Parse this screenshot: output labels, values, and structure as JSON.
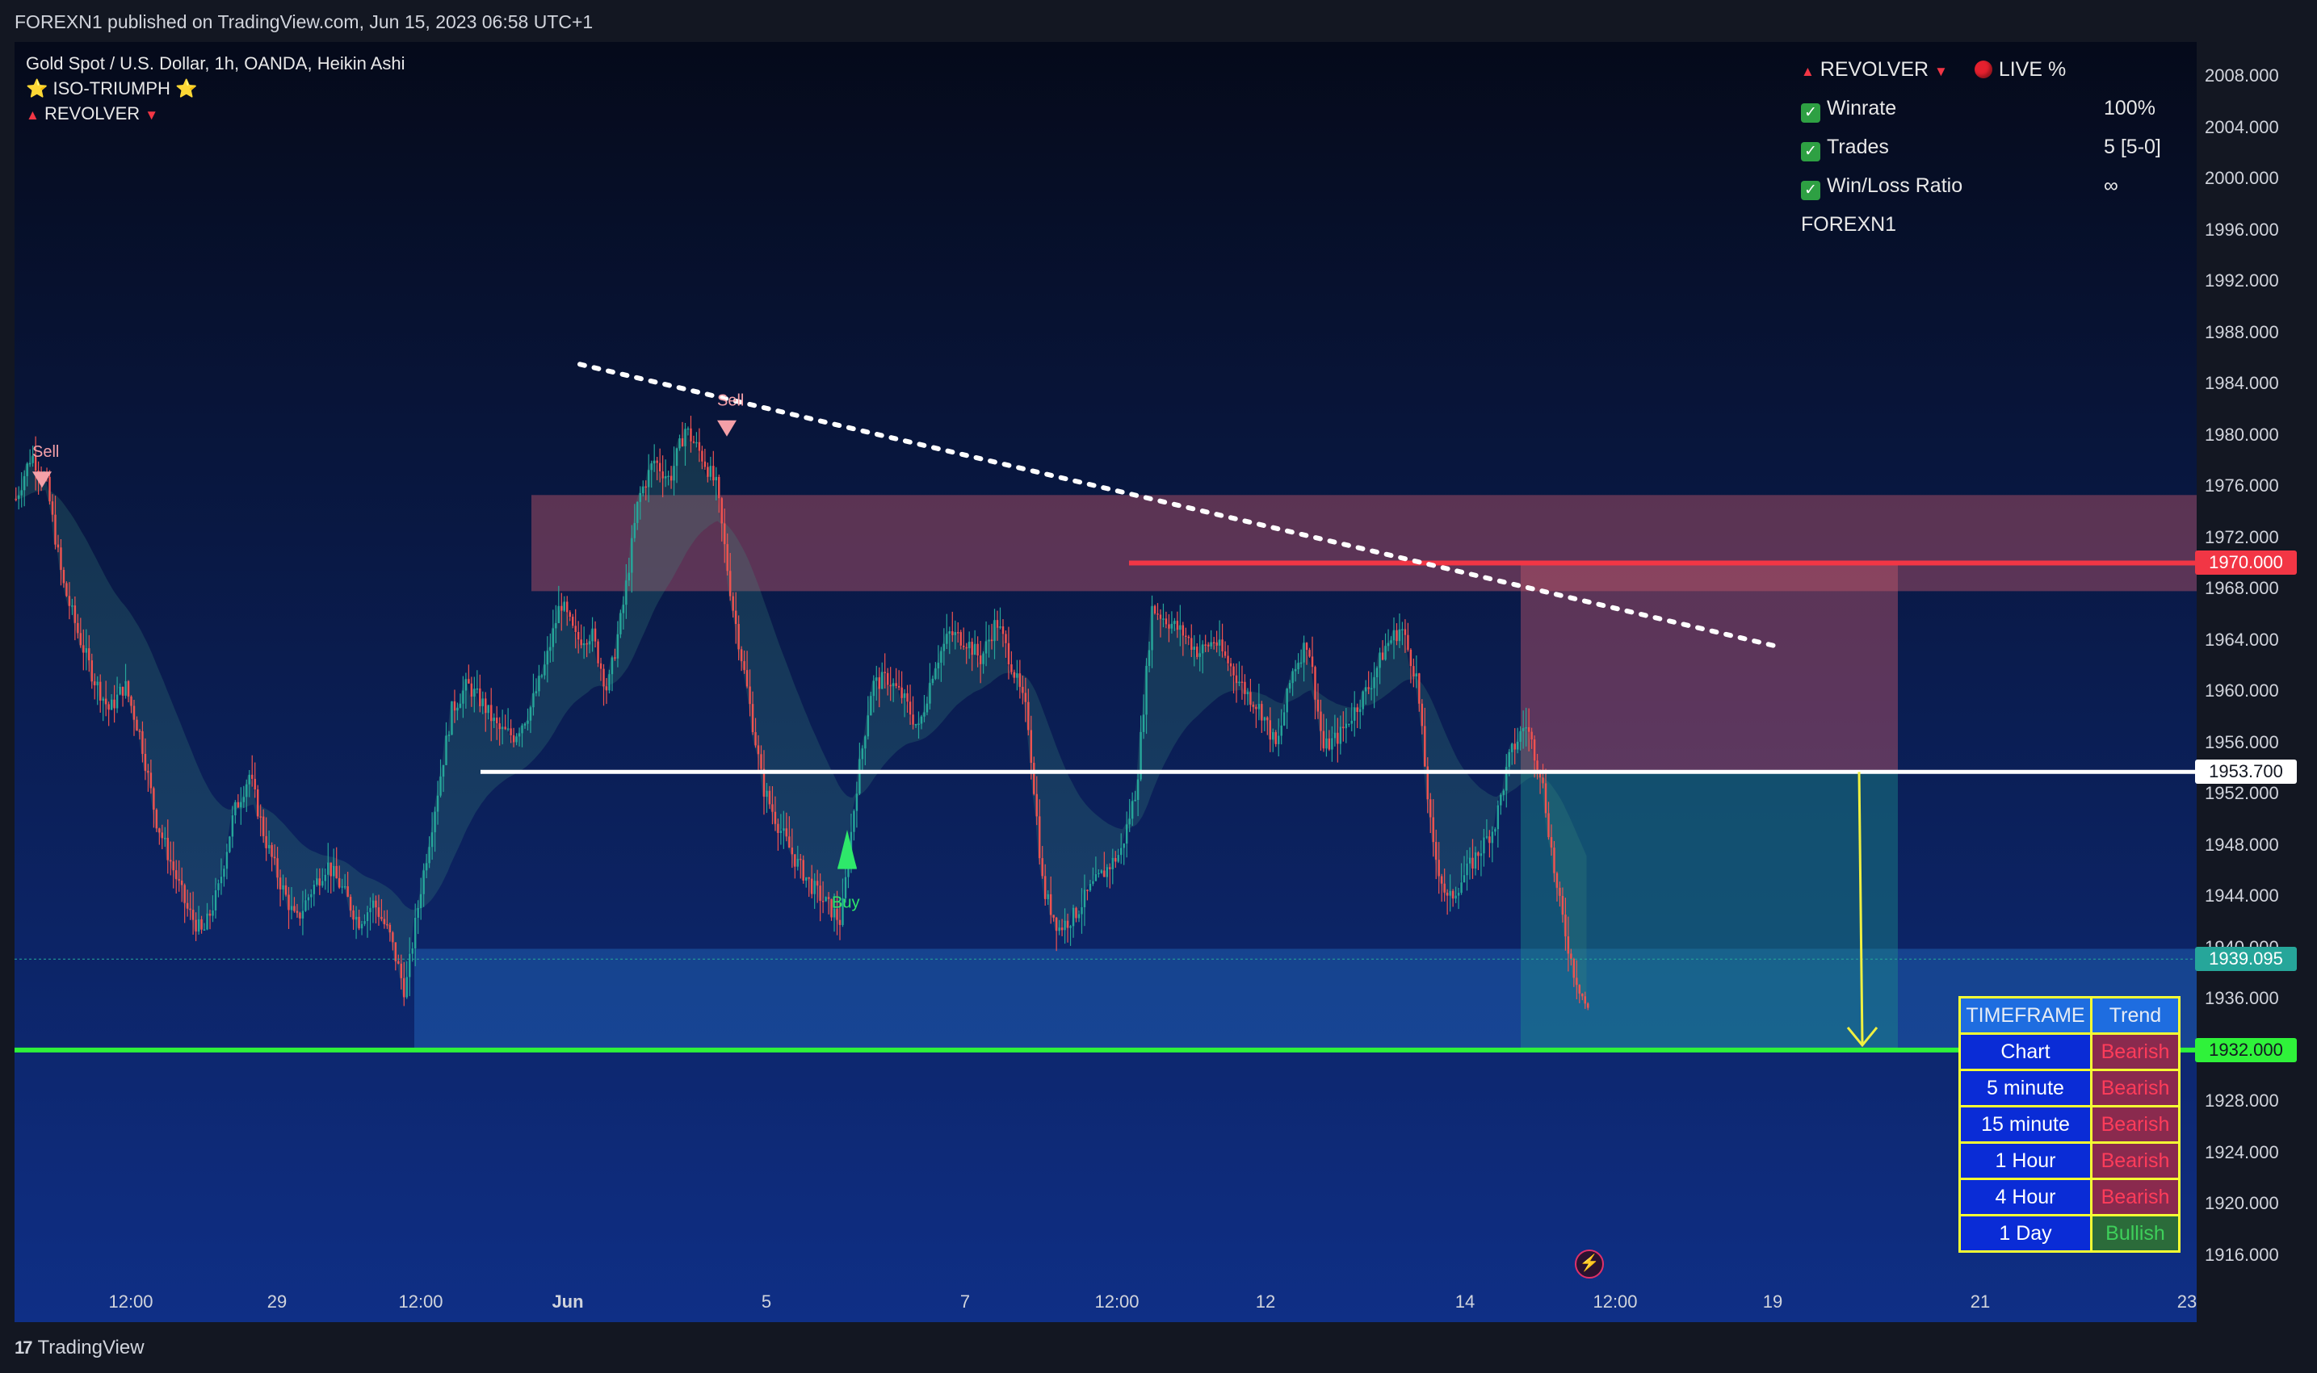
{
  "header": {
    "published": "FOREXN1 published on TradingView.com, Jun 15, 2023 06:58 UTC+1"
  },
  "footer": {
    "brand": "TradingView",
    "logo_mark": "17"
  },
  "legend": {
    "symbol": "Gold Spot / U.S. Dollar, 1h, OANDA, Heikin Ashi",
    "indicator1": "⭐ ISO-TRIUMPH ⭐",
    "indicator2": "REVOLVER"
  },
  "stats": {
    "title": "REVOLVER",
    "live": "LIVE %",
    "rows": [
      {
        "label": "Winrate",
        "value": "100%"
      },
      {
        "label": "Trades",
        "value": "5 [5-0]"
      },
      {
        "label": "Win/Loss Ratio",
        "value": "∞"
      }
    ],
    "author": "FOREXN1"
  },
  "trend_table": {
    "headers": [
      "TIMEFRAME",
      "Trend"
    ],
    "rows": [
      {
        "tf": "Chart",
        "trend": "Bearish"
      },
      {
        "tf": "5 minute",
        "trend": "Bearish"
      },
      {
        "tf": "15 minute",
        "trend": "Bearish"
      },
      {
        "tf": "1 Hour",
        "trend": "Bearish"
      },
      {
        "tf": "4 Hour",
        "trend": "Bearish"
      },
      {
        "tf": "1 Day",
        "trend": "Bullish"
      }
    ]
  },
  "signals": {
    "sell": "Sell",
    "buy": "Buy"
  },
  "colors": {
    "bg_top": "#050a1a",
    "bg_bottom": "#0f2f86",
    "up": "#26a69a",
    "down": "#ef5350",
    "resistance_zone": "#c2566b",
    "support_zone": "#2b7fd9",
    "line_1970": "#f23645",
    "line_1953": "#ffffff",
    "line_1932": "#2ff23a",
    "line_1939": "#26a69a"
  },
  "chart_data": {
    "type": "candlestick",
    "symbol": "XAUUSD",
    "interval": "1h",
    "ylim": [
      1913,
      2011
    ],
    "y_ticks": [
      "2008.000",
      "2004.000",
      "2000.000",
      "1996.000",
      "1992.000",
      "1988.000",
      "1984.000",
      "1980.000",
      "1976.000",
      "1972.000",
      "1968.000",
      "1964.000",
      "1960.000",
      "1956.000",
      "1952.000",
      "1948.000",
      "1944.000",
      "1940.000",
      "1936.000",
      "1932.000",
      "1928.000",
      "1924.000",
      "1920.000",
      "1916.000"
    ],
    "x_ticks": [
      "12:00",
      "29",
      "12:00",
      "Jun",
      "5",
      "7",
      "12:00",
      "12",
      "14",
      "12:00",
      "19",
      "21",
      "23"
    ],
    "price_labels": [
      {
        "value": 1970.0,
        "text": "1970.000"
      },
      {
        "value": 1953.7,
        "text": "1953.700"
      },
      {
        "value": 1939.095,
        "text": "1939.095"
      },
      {
        "value": 1932.0,
        "text": "1932.000"
      }
    ],
    "zones": [
      {
        "name": "resistance",
        "from": 1967.8,
        "to": 1975.3
      },
      {
        "name": "support",
        "from": 1932.0,
        "to": 1939.9
      }
    ],
    "trendline": {
      "from": 1985.5,
      "to": 1963.5,
      "style": "dotted"
    },
    "close_path": [
      1975.0,
      1978.5,
      1976.0,
      1968.5,
      1964.5,
      1961.0,
      1958.5,
      1960.5,
      1956.5,
      1950.0,
      1946.5,
      1943.0,
      1941.0,
      1944.5,
      1950.5,
      1953.5,
      1948.5,
      1945.0,
      1942.0,
      1944.5,
      1946.5,
      1944.5,
      1942.0,
      1943.5,
      1941.0,
      1936.5,
      1944.5,
      1951.5,
      1958.5,
      1960.5,
      1959.0,
      1957.0,
      1956.5,
      1958.5,
      1962.0,
      1967.0,
      1964.0,
      1964.5,
      1960.0,
      1966.5,
      1975.0,
      1978.0,
      1976.5,
      1980.5,
      1978.5,
      1976.0,
      1967.0,
      1960.0,
      1952.5,
      1949.5,
      1947.0,
      1945.0,
      1943.5,
      1942.0,
      1952.5,
      1960.5,
      1961.0,
      1959.5,
      1957.0,
      1962.0,
      1964.5,
      1964.0,
      1962.5,
      1965.5,
      1962.0,
      1958.0,
      1944.5,
      1941.5,
      1942.5,
      1944.5,
      1946.0,
      1947.5,
      1952.5,
      1966.5,
      1965.5,
      1964.5,
      1963.0,
      1964.0,
      1962.0,
      1960.0,
      1958.5,
      1955.5,
      1961.5,
      1964.0,
      1955.5,
      1956.5,
      1958.5,
      1960.5,
      1963.5,
      1965.0,
      1961.0,
      1948.0,
      1943.5,
      1945.5,
      1947.5,
      1949.5,
      1955.0,
      1957.5,
      1953.5,
      1944.5,
      1938.5,
      1935.0
    ]
  }
}
